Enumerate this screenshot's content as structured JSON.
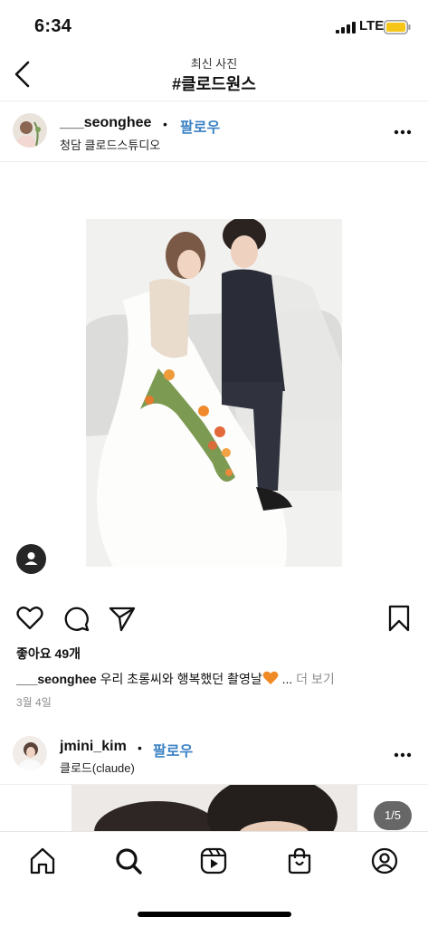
{
  "status_bar": {
    "time": "6:34",
    "network": "LTE",
    "battery_color": "#f5c518"
  },
  "header": {
    "subtitle": "최신 사진",
    "title": "#클로드원스"
  },
  "posts": [
    {
      "username": "___seonghee",
      "dot": "•",
      "follow_label": "팔로우",
      "location": "청담 클로드스튜디오",
      "likes": "좋아요 49개",
      "caption_user": "___seonghee",
      "caption_text": " 우리 초롱씨와 행복했던 촬영날",
      "caption_ellipsis": " ... ",
      "caption_more": "더 보기",
      "date": "3월 4일"
    },
    {
      "username": "jmini_kim",
      "dot": "•",
      "follow_label": "팔로우",
      "location": "클로드(claude)",
      "page_indicator": "1/5"
    }
  ],
  "icons": {
    "back": "chevron-left-icon",
    "more": "more-horizontal-icon",
    "user_tag": "person-icon",
    "like": "heart-icon",
    "comment": "comment-icon",
    "share": "send-icon",
    "save": "bookmark-icon",
    "tabs": [
      "home-icon",
      "search-icon",
      "reels-icon",
      "shop-icon",
      "profile-icon"
    ]
  },
  "colors": {
    "link": "#3b82c4",
    "caption_heart": "#f08a24",
    "muted": "#8e8e8e"
  }
}
